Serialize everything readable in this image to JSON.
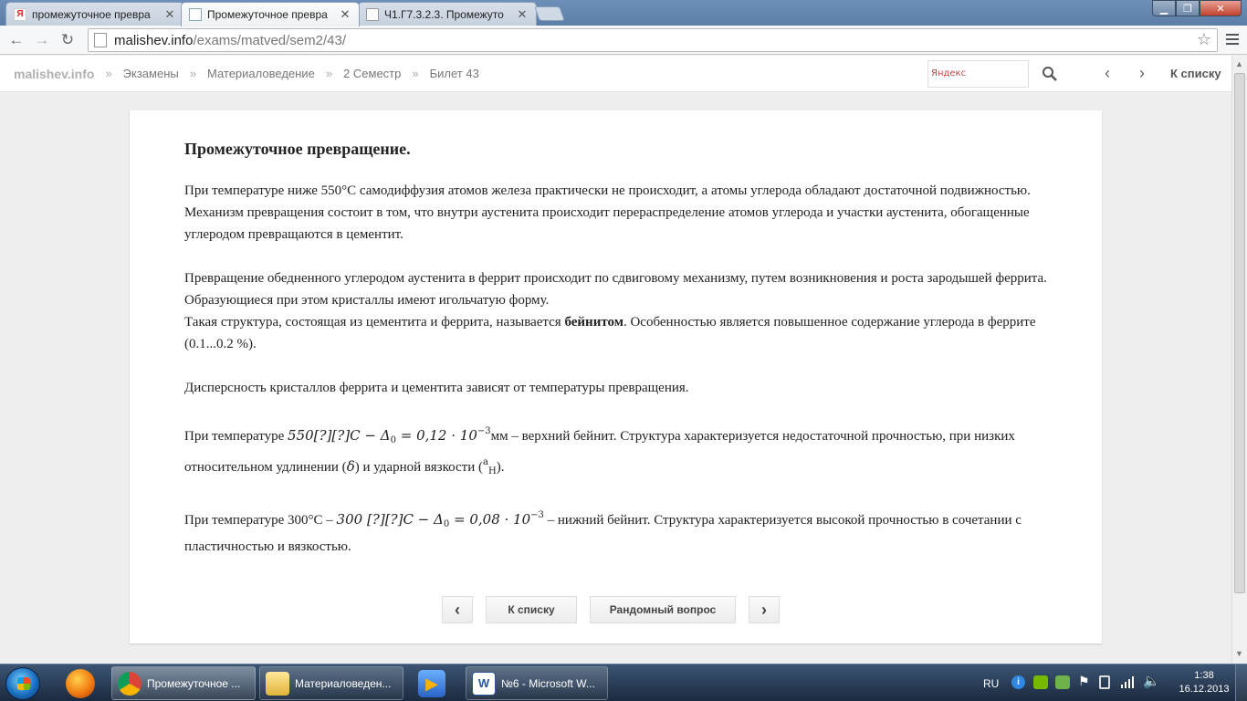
{
  "browser": {
    "tabs": [
      {
        "title": "промежуточное превра",
        "favicon": "yandex-icon"
      },
      {
        "title": "Промежуточное превра",
        "favicon": "page-icon"
      },
      {
        "title": "Ч1.Г7.3.2.3. Промежуто",
        "favicon": "page-icon"
      }
    ],
    "url_host": "malishev.info",
    "url_path": "/exams/matved/sem2/43/"
  },
  "site": {
    "brand": "malishev.info",
    "breadcrumbs": [
      "Экзамены",
      "Материаловедение",
      "2 Семестр",
      "Билет 43"
    ],
    "separator": "»",
    "search_placeholder": "Яндекс",
    "to_list": "К списку"
  },
  "article": {
    "title": "Промежуточное превращение.",
    "p1": "При температуре ниже 550°С самодиффузия атомов железа практически не происходит, а атомы углерода обладают достаточной подвижностью.",
    "p2": "Механизм превращения состоит в том, что внутри аустенита происходит перераспределение атомов углерода и участки аустенита, обогащенные углеродом превращаются в цементит.",
    "p3": "Превращение обедненного углеродом аустенита в феррит происходит по сдвиговому механизму, путем возникновения и роста зародышей феррита. Образующиеся при этом кристаллы имеют игольчатую форму.",
    "p4_before": "Такая структура, состоящая из цементита и феррита, называется ",
    "p4_bold": "бейнитом",
    "p4_after": ". Особенностью является повышенное содержание углерода в феррите (0.1...0.2 %).",
    "p5": "Дисперсность кристаллов феррита и цементита зависят от температуры превращения.",
    "p6_before": "При температуре ",
    "p6_math": "550[?][?]C − Δ",
    "p6_math_sub": "0",
    "p6_math_rest": " = 0,12 · 10",
    "p6_math_exp": "−3",
    "p6_after": "мм – верхний бейнит. Структура характеризуется недостаточной прочностью, при низких относительном удлинении (",
    "p6_delta": "δ",
    "p6_mid": ") и ударной вязкости (",
    "p6_a": "a",
    "p6_a_sub": "H",
    "p6_end": ").",
    "p7_before": "При температуре 300°С – ",
    "p7_math": "300 [?][?]C − Δ",
    "p7_math_sub": "0",
    "p7_math_rest": " = 0,08 · 10",
    "p7_math_exp": "−3",
    "p7_after": " – нижний бейнит. Структура характеризуется высокой прочностью в сочетании с пластичностью и вязкостью."
  },
  "pager": {
    "to_list": "К списку",
    "random": "Рандомный вопрос"
  },
  "taskbar": {
    "items": [
      {
        "label": "Промежуточное ...",
        "icon": "chrome-icon"
      },
      {
        "label": "Материаловеден...",
        "icon": "folder-icon"
      },
      {
        "label": "№6 - Microsoft W...",
        "icon": "word-icon"
      }
    ],
    "lang": "RU",
    "time": "1:38",
    "date": "16.12.2013"
  }
}
